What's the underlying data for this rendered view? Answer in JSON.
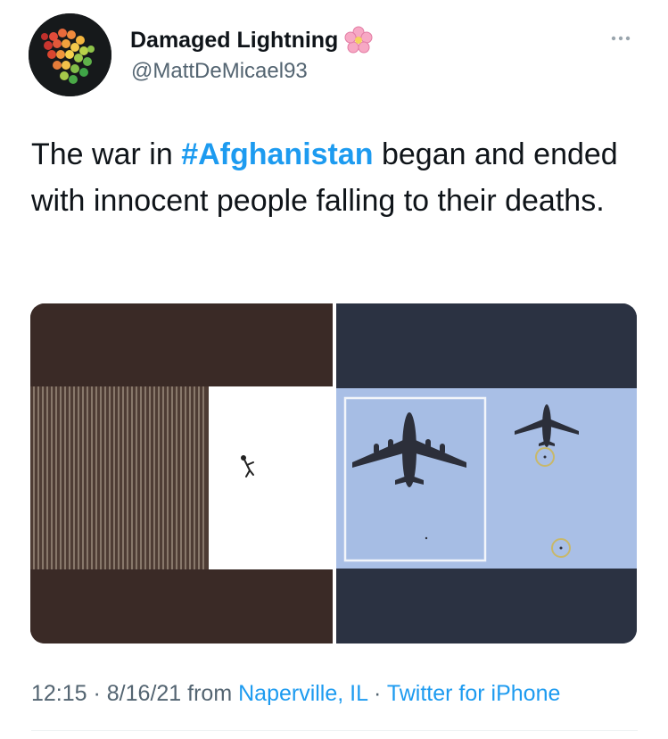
{
  "author": {
    "display_name": "Damaged Lightning",
    "handle": "@MattDeMicael93",
    "name_emoji_icon": "cherry-blossom-icon",
    "avatar_icon": "colorful-mosaic-logo"
  },
  "more_icon": "more-options-icon",
  "tweet": {
    "text_before": "The war in ",
    "hashtag": "#Afghanistan",
    "text_after": " began and ended with innocent people falling to their deaths."
  },
  "media": {
    "left_image": "person-falling-beside-tower",
    "right_image": "military-cargo-plane-with-falling-people"
  },
  "meta": {
    "time": "12:15",
    "separator": " · ",
    "date": "8/16/21",
    "from_label": " from ",
    "location": "Naperville, IL",
    "client": "Twitter for iPhone"
  },
  "colors": {
    "link": "#1d9bf0",
    "text": "#0f1419",
    "muted": "#536471"
  }
}
